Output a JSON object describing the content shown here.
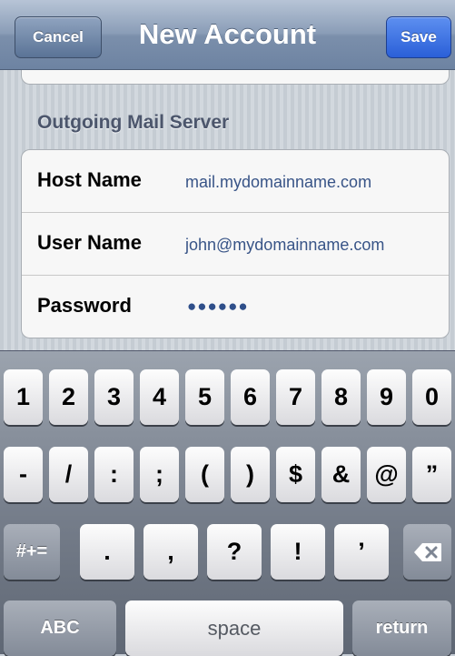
{
  "navbar": {
    "title": "New Account",
    "cancel_label": "Cancel",
    "save_label": "Save"
  },
  "section": {
    "header": "Outgoing Mail Server"
  },
  "fields": [
    {
      "label": "Host Name",
      "value": "mail.mydomainname.com"
    },
    {
      "label": "User Name",
      "value": "john@mydomainname.com"
    },
    {
      "label": "Password",
      "value": "●●●●●●"
    }
  ],
  "keyboard": {
    "row1": [
      "1",
      "2",
      "3",
      "4",
      "5",
      "6",
      "7",
      "8",
      "9",
      "0"
    ],
    "row2": [
      "-",
      "/",
      ":",
      ";",
      "(",
      ")",
      "$",
      "&",
      "@",
      "”"
    ],
    "row3": [
      ".",
      ",",
      "?",
      "!",
      "’"
    ],
    "symbols_label": "#+=",
    "delete_icon": "backspace-icon",
    "abc_label": "ABC",
    "space_label": "space",
    "return_label": "return"
  }
}
